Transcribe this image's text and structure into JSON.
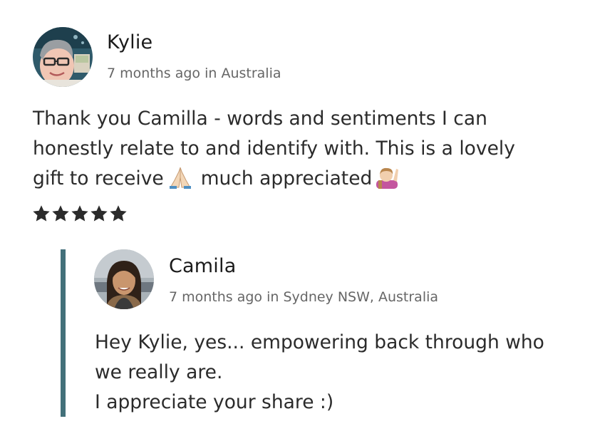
{
  "review": {
    "author": "Kylie",
    "meta": "7 months ago in Australia",
    "lines": [
      "Thank you Camilla - words and sentiments I can",
      "honestly relate to and identify with.  This is a lovely",
      "gift to receive",
      "much appreciated"
    ],
    "emojis": [
      "folded-hands-icon",
      "person-raising-hand-icon"
    ],
    "rating": 5,
    "rating_max": 5,
    "star_color": "#2b2b2b"
  },
  "reply": {
    "author": "Camila",
    "meta": "7 months ago in Sydney NSW, Australia",
    "lines": [
      "Hey Kylie, yes... empowering back through who",
      "we really are.",
      "I appreciate your share :)"
    ],
    "bar_color": "#43707a"
  }
}
